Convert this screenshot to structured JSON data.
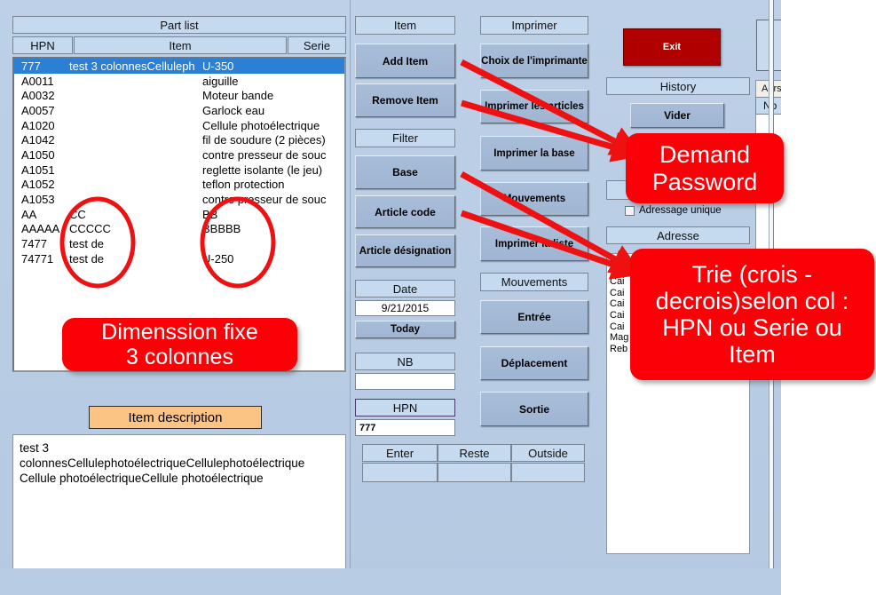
{
  "window": {
    "part_list": {
      "title": "Part list",
      "columns": [
        "HPN",
        "Item",
        "Serie"
      ],
      "rows": [
        {
          "hpn": "777",
          "mid": "test 3 colonnesCelluleph",
          "serie": "U-350",
          "selected": true
        },
        {
          "hpn": "A0011",
          "mid": "",
          "serie": "aiguille",
          "selected": false
        },
        {
          "hpn": "A0032",
          "mid": "",
          "serie": "Moteur bande",
          "selected": false
        },
        {
          "hpn": "A0057",
          "mid": "",
          "serie": "Garlock eau",
          "selected": false
        },
        {
          "hpn": "A1020",
          "mid": "",
          "serie": "Cellule photoélectrique",
          "selected": false
        },
        {
          "hpn": "A1042",
          "mid": "",
          "serie": "fil de soudure (2 pièces)",
          "selected": false
        },
        {
          "hpn": "A1050",
          "mid": "",
          "serie": "contre presseur de souc",
          "selected": false
        },
        {
          "hpn": "A1051",
          "mid": "",
          "serie": "reglette isolante (le jeu)",
          "selected": false
        },
        {
          "hpn": "A1052",
          "mid": "",
          "serie": "teflon protection",
          "selected": false
        },
        {
          "hpn": "A1053",
          "mid": "",
          "serie": "contre presseur de souc",
          "selected": false
        },
        {
          "hpn": "AA",
          "mid": "CC",
          "serie": "BB",
          "selected": false
        },
        {
          "hpn": "AAAAA",
          "mid": "CCCCC",
          "serie": "BBBBB",
          "selected": false
        },
        {
          "hpn": "7477",
          "mid": "test de",
          "serie": "",
          "selected": false
        },
        {
          "hpn": "74771",
          "mid": "test de",
          "serie": "U-250",
          "selected": false
        }
      ]
    },
    "item_description": {
      "title": "Item description",
      "text": "test 3\ncolonnesCellulephotoélectriqueCellulephotoélectrique\nCellule photoélectriqueCellule photoélectrique"
    },
    "item_section": {
      "title": "Item",
      "add_item": "Add Item",
      "remove_item": "Remove Item"
    },
    "filter_section": {
      "title": "Filter",
      "base": "Base",
      "article_code": "Article code",
      "article_designation": "Article désignation"
    },
    "date_section": {
      "title": "Date",
      "value": "9/21/2015",
      "today": "Today"
    },
    "nb_section": {
      "title": "NB",
      "value": ""
    },
    "hpn_section": {
      "title": "HPN",
      "value": "777"
    },
    "totals_row": {
      "headers": [
        "Enter",
        "Reste",
        "Outside"
      ],
      "values": [
        "",
        "",
        ""
      ]
    },
    "print_section": {
      "title": "Imprimer",
      "buttons": [
        "Choix de l'imprimante",
        "Imprimer les articles",
        "Imprimer la base",
        "Mouvements",
        "Imprimer la liste"
      ]
    },
    "movements_section": {
      "title": "Mouvements",
      "buttons": [
        "Entrée",
        "Déplacement",
        "Sortie"
      ]
    },
    "right_panel": {
      "exit": "Exit",
      "history_title": "History",
      "vider": "Vider",
      "checkbox_label": "Adressage unique",
      "checkbox_checked": false,
      "adresse_title": "Adresse",
      "list_items": [
        "Cai",
        "Cai",
        "Cai",
        "Cai",
        "Cai",
        "Cai",
        "Cai",
        "Mag",
        "Reb"
      ]
    },
    "far_right": {
      "adrs_tab": "Adrs",
      "nb_header": "Nb"
    }
  },
  "annotations": {
    "dimension": "Dimenssion fixe\n3 colonnes",
    "password": "Demand\nPassword",
    "trie": "Trie (crois - decrois)selon col : HPN ou Serie ou Item"
  },
  "colors": {
    "accent_red": "#fb0007",
    "exit_red": "#b00000",
    "selection_blue": "#2b7fd4",
    "panel_blue": "#b8cce4",
    "label_blue": "#c5d9ef",
    "button_blue": "#a8bdd8",
    "desc_orange": "#fbc485"
  }
}
